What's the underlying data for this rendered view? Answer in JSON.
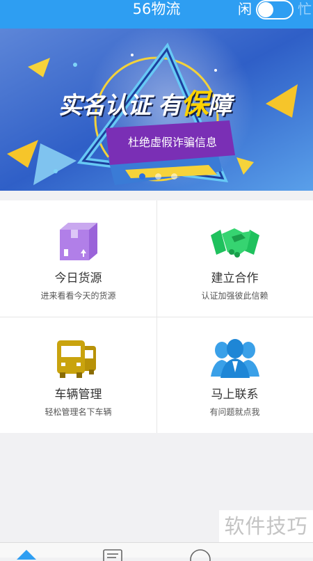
{
  "header": {
    "title": "56物流",
    "status_idle": "闲",
    "status_busy": "忙",
    "toggle_on": false,
    "color": "#2e9ef2"
  },
  "banner": {
    "headline_part1": "实名认证 有",
    "headline_highlight": "保",
    "headline_part2": "障",
    "subtitle": "杜绝虚假诈骗信息",
    "pager_total": 3,
    "pager_active": 1
  },
  "features": [
    {
      "name": "今日货源",
      "desc": "进来看看今天的货源",
      "icon": "package-box-icon"
    },
    {
      "name": "建立合作",
      "desc": "认证加强彼此信赖",
      "icon": "handshake-icon"
    },
    {
      "name": "车辆管理",
      "desc": "轻松管理名下车辆",
      "icon": "trucks-icon"
    },
    {
      "name": "马上联系",
      "desc": "有问题就点我",
      "icon": "people-icon"
    }
  ],
  "watermark": "软件技巧",
  "tabbar": {
    "tabs": [
      {
        "icon": "home-icon",
        "active": true
      },
      {
        "icon": "document-icon",
        "active": false
      },
      {
        "icon": "profile-icon",
        "active": false
      }
    ]
  }
}
